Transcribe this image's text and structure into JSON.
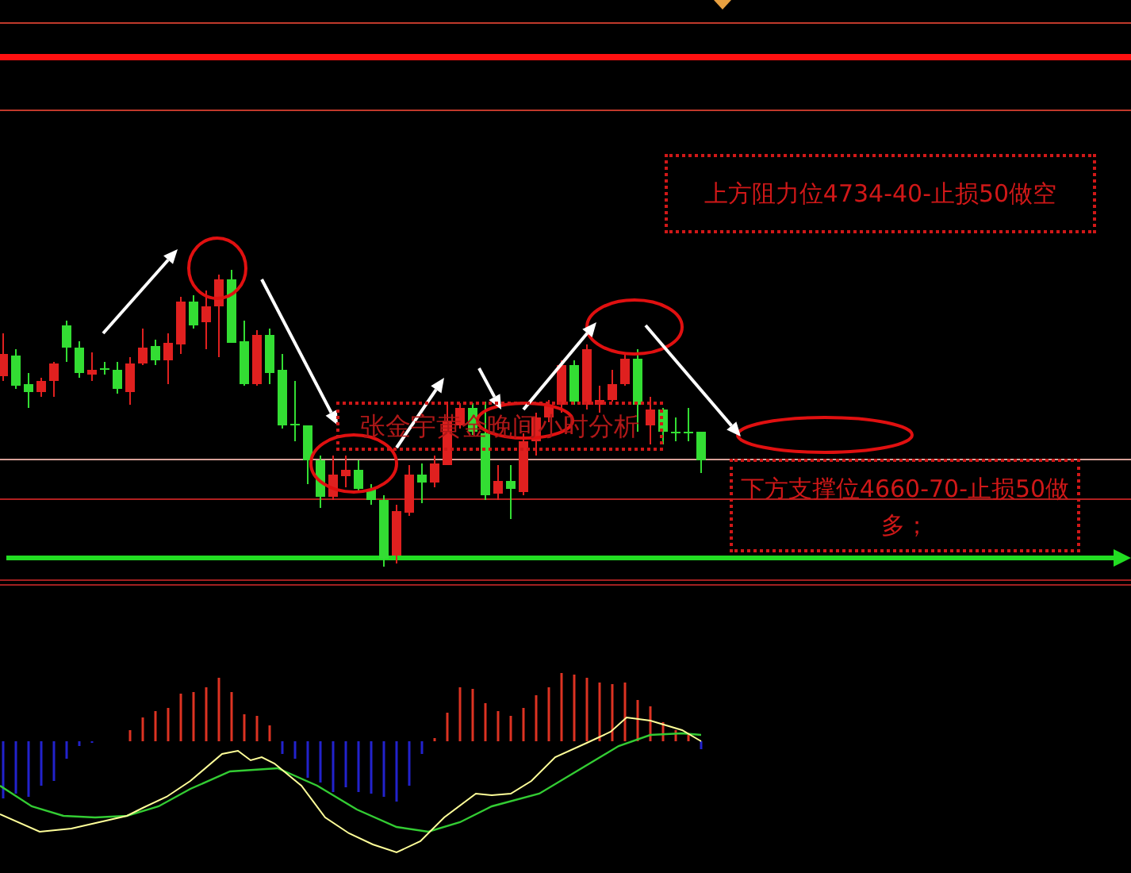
{
  "annotations": [
    {
      "kind": "resistance",
      "text": "上方阻力位4734-40-止损50做空"
    },
    {
      "kind": "title",
      "text": "张金宇黄金晚间小时分析"
    },
    {
      "kind": "support",
      "text": "下方支撑位4660-70-止损50做多；"
    }
  ]
}
